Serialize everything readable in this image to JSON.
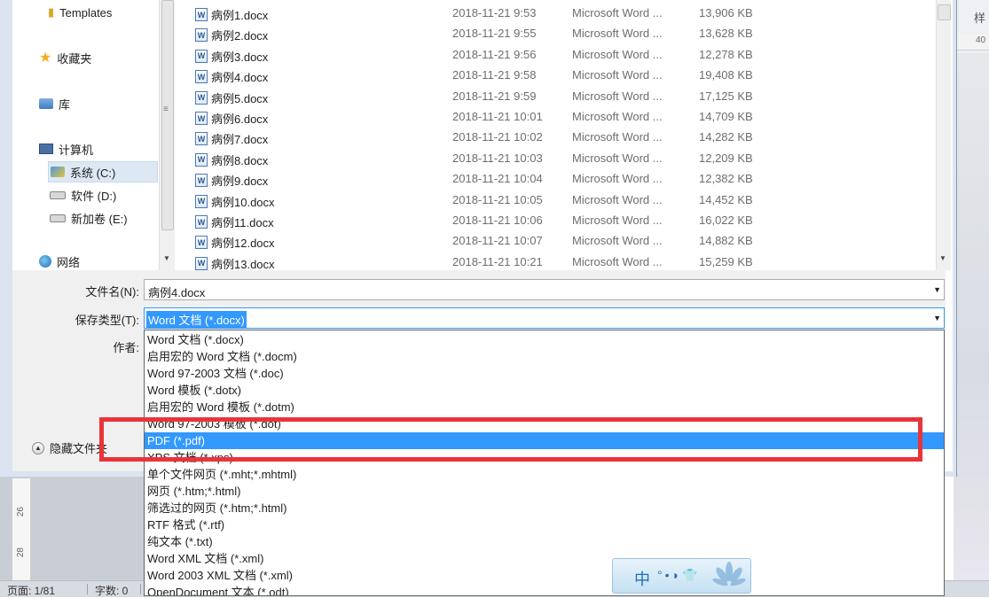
{
  "background": {
    "ribbon_text": "样",
    "ruler_top_text": "40",
    "ruler_left_marks": [
      "26",
      "28"
    ],
    "status_bar": {
      "page": "页面: 1/81",
      "words": "字数: 0"
    },
    "ime": {
      "mode": "中",
      "icons": "°•◗👕"
    }
  },
  "nav": {
    "items": [
      {
        "label": "Templates",
        "icon": "folder-icon",
        "glyph": "📁"
      },
      {
        "label": "收藏夹",
        "icon": "star-icon",
        "glyph": "★"
      },
      {
        "label": "库",
        "icon": "library-icon",
        "glyph": "🗂"
      },
      {
        "label": "计算机",
        "icon": "computer-icon",
        "glyph": "🖥"
      },
      {
        "label": "系统 (C:)",
        "icon": "drive-c-icon",
        "glyph": "💽"
      },
      {
        "label": "软件 (D:)",
        "icon": "drive-icon",
        "glyph": "▭"
      },
      {
        "label": "新加卷 (E:)",
        "icon": "drive-icon",
        "glyph": "▭"
      },
      {
        "label": "网络",
        "icon": "network-icon",
        "glyph": "🌐"
      }
    ]
  },
  "files": [
    {
      "name": "病例1.docx",
      "date": "2018-11-21 9:53",
      "type": "Microsoft Word ...",
      "size": "13,906 KB"
    },
    {
      "name": "病例2.docx",
      "date": "2018-11-21 9:55",
      "type": "Microsoft Word ...",
      "size": "13,628 KB"
    },
    {
      "name": "病例3.docx",
      "date": "2018-11-21 9:56",
      "type": "Microsoft Word ...",
      "size": "12,278 KB"
    },
    {
      "name": "病例4.docx",
      "date": "2018-11-21 9:58",
      "type": "Microsoft Word ...",
      "size": "19,408 KB"
    },
    {
      "name": "病例5.docx",
      "date": "2018-11-21 9:59",
      "type": "Microsoft Word ...",
      "size": "17,125 KB"
    },
    {
      "name": "病例6.docx",
      "date": "2018-11-21 10:01",
      "type": "Microsoft Word ...",
      "size": "14,709 KB"
    },
    {
      "name": "病例7.docx",
      "date": "2018-11-21 10:02",
      "type": "Microsoft Word ...",
      "size": "14,282 KB"
    },
    {
      "name": "病例8.docx",
      "date": "2018-11-21 10:03",
      "type": "Microsoft Word ...",
      "size": "12,209 KB"
    },
    {
      "name": "病例9.docx",
      "date": "2018-11-21 10:04",
      "type": "Microsoft Word ...",
      "size": "12,382 KB"
    },
    {
      "name": "病例10.docx",
      "date": "2018-11-21 10:05",
      "type": "Microsoft Word ...",
      "size": "14,452 KB"
    },
    {
      "name": "病例11.docx",
      "date": "2018-11-21 10:06",
      "type": "Microsoft Word ...",
      "size": "16,022 KB"
    },
    {
      "name": "病例12.docx",
      "date": "2018-11-21 10:07",
      "type": "Microsoft Word ...",
      "size": "14,882 KB"
    },
    {
      "name": "病例13.docx",
      "date": "2018-11-21 10:21",
      "type": "Microsoft Word ...",
      "size": "15,259 KB"
    }
  ],
  "form": {
    "filename_label": "文件名(N):",
    "filename_value": "病例4.docx",
    "savetype_label": "保存类型(T):",
    "savetype_value": "Word 文档 (*.docx)",
    "author_label": "作者:",
    "hide_folders": "隐藏文件夹"
  },
  "save_types": [
    {
      "label": "Word 文档 (*.docx)"
    },
    {
      "label": "启用宏的 Word 文档 (*.docm)"
    },
    {
      "label": "Word 97-2003 文档 (*.doc)"
    },
    {
      "label": "Word 模板 (*.dotx)"
    },
    {
      "label": "启用宏的 Word 模板 (*.dotm)"
    },
    {
      "label": "Word 97-2003 模板 (*.dot)"
    },
    {
      "label": "PDF (*.pdf)",
      "selected": true
    },
    {
      "label": "XPS 文档 (*.xps)"
    },
    {
      "label": "单个文件网页 (*.mht;*.mhtml)"
    },
    {
      "label": "网页 (*.htm;*.html)"
    },
    {
      "label": "筛选过的网页 (*.htm;*.html)"
    },
    {
      "label": "RTF 格式 (*.rtf)"
    },
    {
      "label": "纯文本 (*.txt)"
    },
    {
      "label": "Word XML 文档 (*.xml)"
    },
    {
      "label": "Word 2003 XML 文档 (*.xml)"
    },
    {
      "label": "OpenDocument 文本 (*.odt)"
    }
  ],
  "colors": {
    "selection": "#3399ff",
    "highlight_box": "#e8343b"
  }
}
